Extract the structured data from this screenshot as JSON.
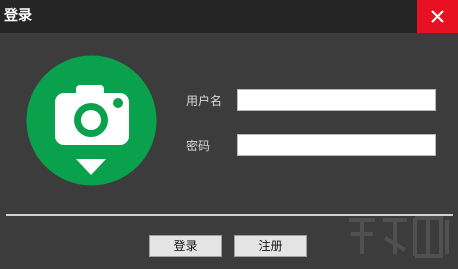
{
  "window": {
    "title": "登录"
  },
  "colors": {
    "brand_green": "#0aa14c",
    "close_red": "#e81123"
  },
  "form": {
    "username_label": "用户名",
    "username_value": "",
    "password_label": "密码",
    "password_value": ""
  },
  "buttons": {
    "login": "登录",
    "register": "注册"
  }
}
